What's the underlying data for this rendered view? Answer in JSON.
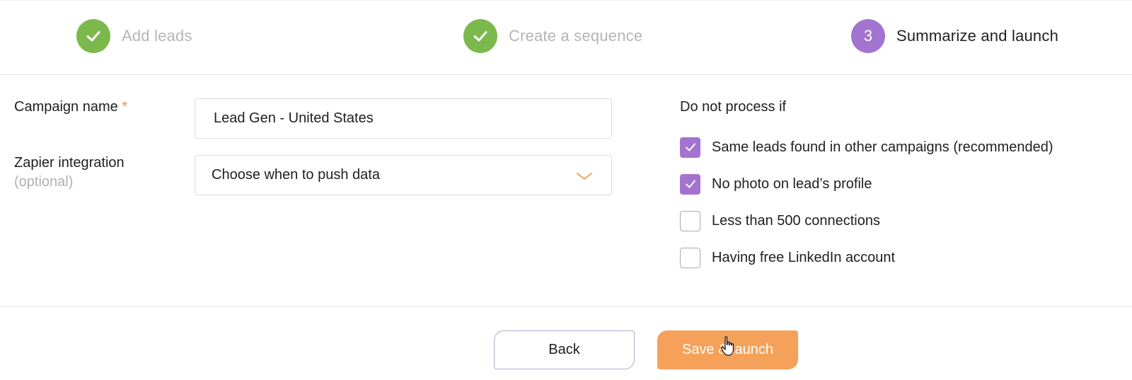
{
  "stepper": {
    "steps": [
      {
        "label": "Add leads",
        "state": "done",
        "icon": "check-icon"
      },
      {
        "label": "Create a sequence",
        "state": "done",
        "icon": "check-icon"
      },
      {
        "number": "3",
        "label": "Summarize and launch",
        "state": "active"
      }
    ]
  },
  "form": {
    "campaign_name": {
      "label": "Campaign name",
      "required_mark": "*",
      "value": "Lead Gen - United States"
    },
    "zapier": {
      "label": "Zapier integration",
      "optional_text": "(optional)",
      "selected": "Choose when to push data",
      "icon": "chevron-down-icon"
    }
  },
  "exclusions": {
    "title": "Do not process if",
    "options": [
      {
        "label": "Same leads found in other campaigns (recommended)",
        "checked": true
      },
      {
        "label": "No photo on lead’s profile",
        "checked": true
      },
      {
        "label": "Less than 500 connections",
        "checked": false
      },
      {
        "label": "Having free LinkedIn account",
        "checked": false
      }
    ]
  },
  "footer": {
    "back_label": "Back",
    "launch_label": "Save & launch"
  },
  "colors": {
    "done_green": "#7cb94c",
    "active_purple": "#a374cf",
    "accent_orange": "#f5a15a",
    "required_orange": "#f08c3c"
  }
}
